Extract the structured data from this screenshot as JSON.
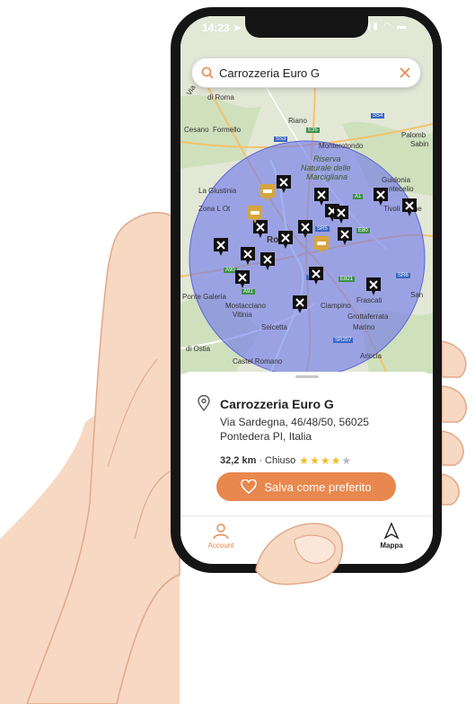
{
  "search": {
    "value": "Carrozzeria Euro G"
  },
  "map": {
    "labels": {
      "roma_top": "di Roma",
      "via": "Via",
      "riano": "Riano",
      "cesano": "Cesano",
      "formello": "Formello",
      "monterotondo": "Monterotondo",
      "riserva1": "Riserva",
      "riserva2": "Naturale delle",
      "riserva3": "Marcigliana",
      "palomb1": "Palomb",
      "palomb2": "Sabin",
      "giustiniana": "La Giustinia",
      "guidonia1": "Guidonia",
      "guidonia2": "ntecelio",
      "zona": "Zona L Ot",
      "tivoli": "Tivoli Terme",
      "roma": "Roma",
      "ponte_galeria": "Ponte Galeria",
      "mostacciano": "Mostacciano",
      "vitinia": "Vitinia",
      "ciampino": "Ciampino",
      "frascati": "Frascati",
      "grottaferrata": "Grottaferrata",
      "marino": "Marino",
      "san": "San",
      "selcetta": "Selcetta",
      "ostia": "di Ostia",
      "castel_romano": "Castel Romano",
      "ariccia": "Ariccia"
    },
    "roads": {
      "s54": "SS4",
      "e35": "E35",
      "s53": "SS3",
      "a1": "A1",
      "s55": "SR5",
      "e80": "E80",
      "s57": "SS7",
      "a90": "A90",
      "a91": "A91",
      "e821": "E821",
      "s56": "SR6",
      "sr207": "SR207"
    }
  },
  "place": {
    "name": "Carrozzeria Euro G",
    "address": "Via Sardegna, 46/48/50, 56025 Pontedera PI, Italia",
    "distance": "32,2 km",
    "separator": "·",
    "status": "Chiuso",
    "rating": 4,
    "rating_max": 5
  },
  "actions": {
    "favorite": "Salva come preferito"
  },
  "tabs": {
    "account": "Account",
    "map": "Mappa"
  },
  "colors": {
    "accent": "#e8884f",
    "radius": "#6f78ec",
    "star": "#f0b928"
  }
}
